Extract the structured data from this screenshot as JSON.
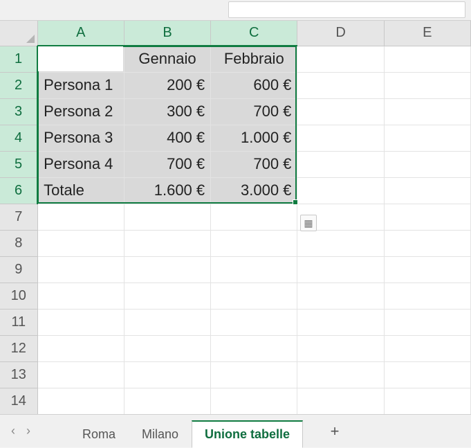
{
  "columns": [
    "A",
    "B",
    "C",
    "D",
    "E"
  ],
  "rows": [
    "1",
    "2",
    "3",
    "4",
    "5",
    "6",
    "7",
    "8",
    "9",
    "10",
    "11",
    "12",
    "13",
    "14"
  ],
  "selected_cols": [
    0,
    1,
    2
  ],
  "selected_rows": [
    0,
    1,
    2,
    3,
    4,
    5
  ],
  "cells": {
    "r0": {
      "A": "",
      "B": "Gennaio",
      "C": "Febbraio"
    },
    "r1": {
      "A": "Persona 1",
      "B": "200 €",
      "C": "600 €"
    },
    "r2": {
      "A": "Persona 2",
      "B": "300 €",
      "C": "700 €"
    },
    "r3": {
      "A": "Persona 3",
      "B": "400 €",
      "C": "1.000 €"
    },
    "r4": {
      "A": "Persona 4",
      "B": "700 €",
      "C": "700 €"
    },
    "r5": {
      "A": "Totale",
      "B": "1.600 €",
      "C": "3.000 €"
    }
  },
  "tabs": {
    "prev_icon": "‹",
    "next_icon": "›",
    "items": [
      {
        "label": "Roma",
        "active": false
      },
      {
        "label": "Milano",
        "active": false
      },
      {
        "label": "Unione tabelle",
        "active": true
      }
    ],
    "add_icon": "+"
  },
  "quick_analysis_icon": "▦",
  "chart_data": {
    "type": "table",
    "columns": [
      "",
      "Gennaio",
      "Febbraio"
    ],
    "rows": [
      [
        "Persona 1",
        200,
        600
      ],
      [
        "Persona 2",
        300,
        700
      ],
      [
        "Persona 3",
        400,
        1000
      ],
      [
        "Persona 4",
        700,
        700
      ],
      [
        "Totale",
        1600,
        3000
      ]
    ],
    "currency": "€"
  }
}
